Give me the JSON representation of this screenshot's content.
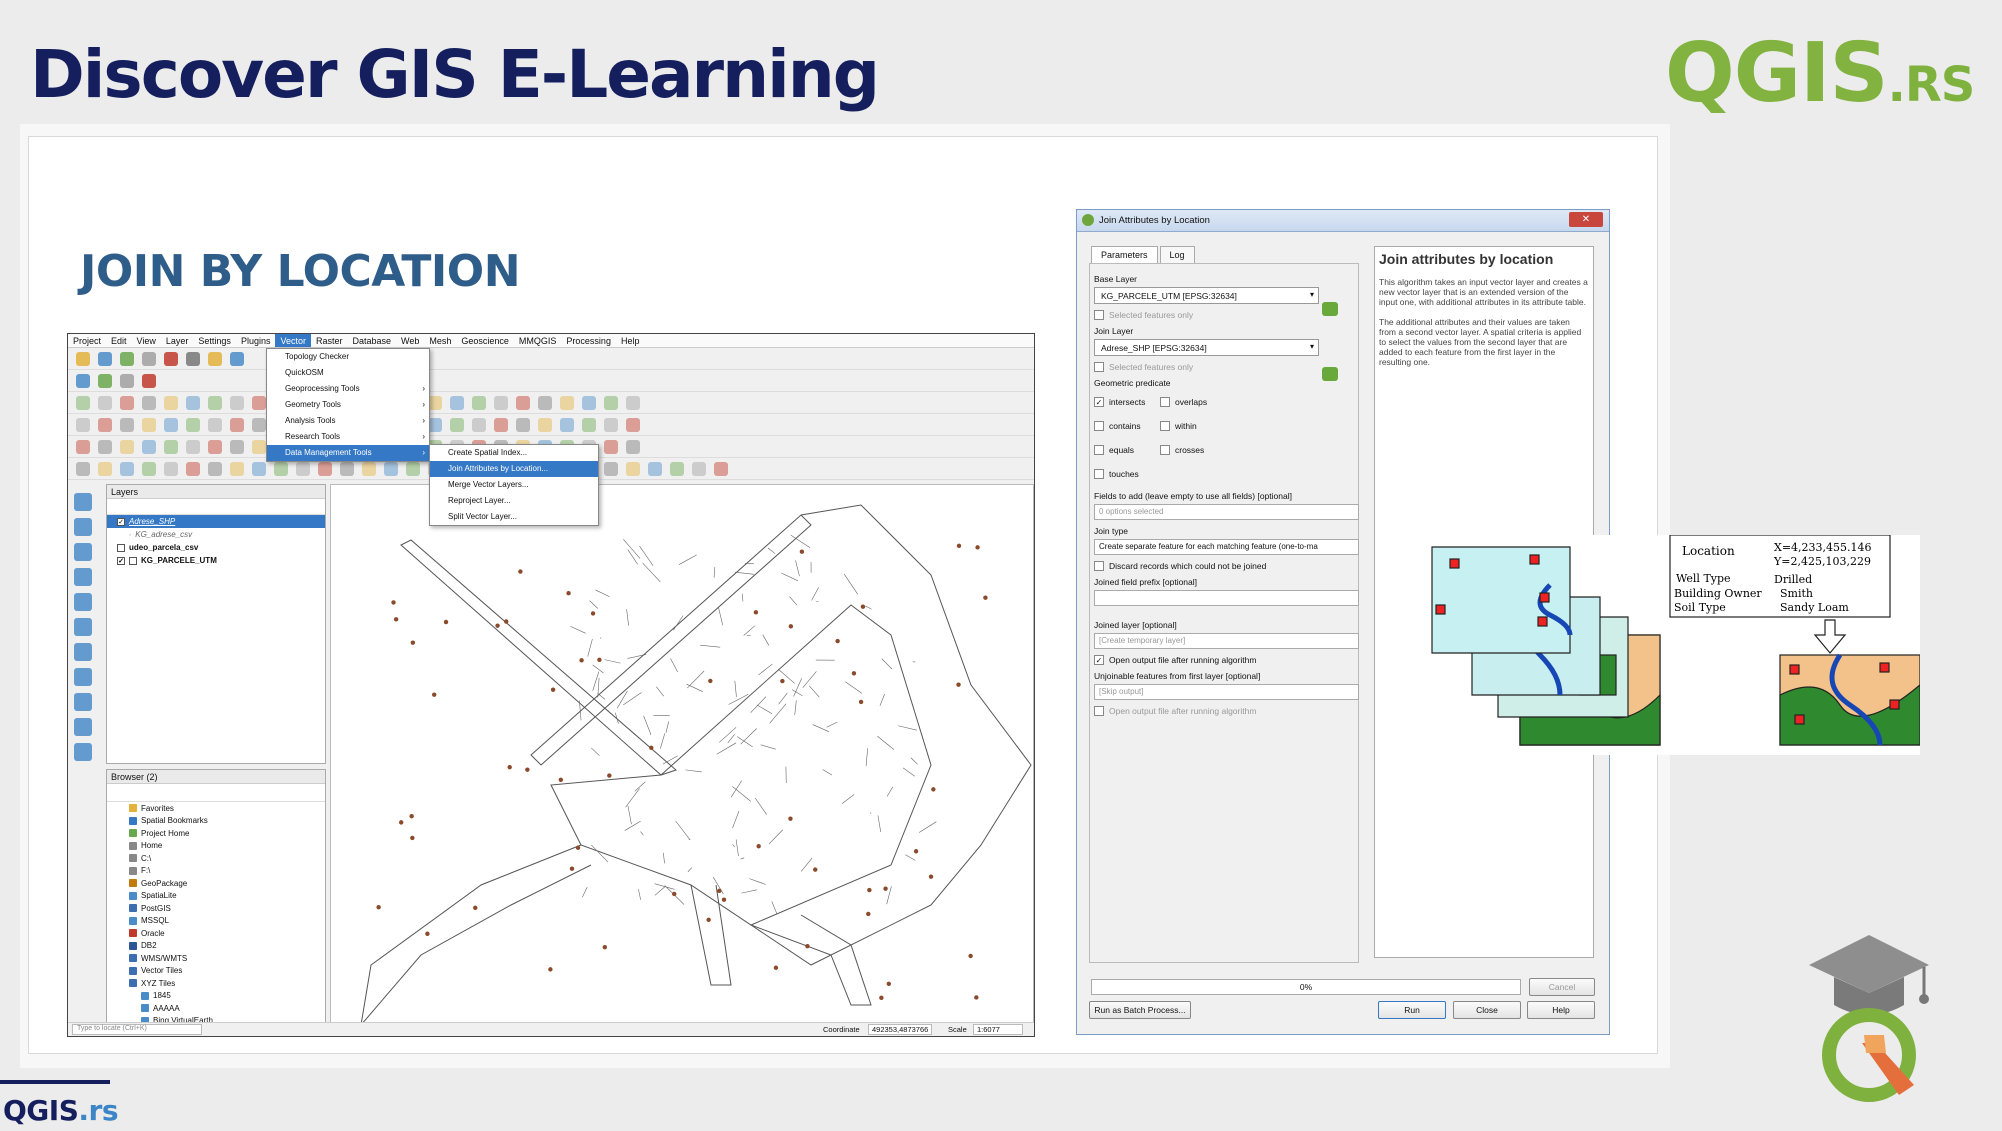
{
  "header": {
    "title": "Discover GIS E-Learning",
    "brand": "QGIS",
    "brand_suffix": ".RS"
  },
  "slide": {
    "section_title": "JOIN BY LOCATION"
  },
  "qgis": {
    "menu": [
      "Project",
      "Edit",
      "View",
      "Layer",
      "Settings",
      "Plugins",
      "Vector",
      "Raster",
      "Database",
      "Web",
      "Mesh",
      "Geoscience",
      "MMQGIS",
      "Processing",
      "Help"
    ],
    "vector_menu": [
      "Topology Checker",
      "QuickOSM",
      "Geoprocessing Tools",
      "Geometry Tools",
      "Analysis Tools",
      "Research Tools",
      "Data Management Tools"
    ],
    "submenu": [
      "Create Spatial Index...",
      "Join Attributes by Location...",
      "Merge Vector Layers...",
      "Reproject Layer...",
      "Split Vector Layer..."
    ],
    "layers_title": "Layers",
    "layers": [
      "Adrese_SHP",
      "KG_adrese_csv",
      "udeo_parcela_csv",
      "KG_PARCELE_UTM"
    ],
    "browser_title": "Browser (2)",
    "browser": [
      "Favorites",
      "Spatial Bookmarks",
      "Project Home",
      "Home",
      "C:\\",
      "F:\\",
      "GeoPackage",
      "SpatiaLite",
      "PostGIS",
      "MSSQL",
      "Oracle",
      "DB2",
      "WMS/WMTS",
      "Vector Tiles",
      "XYZ Tiles",
      "1845",
      "AAAAA",
      "Bing VirtualEarth"
    ],
    "locate_placeholder": "Type to locate (Ctrl+K)",
    "coordinate_label": "Coordinate",
    "coordinate_value": "492353,4873766",
    "scale_label": "Scale",
    "scale_value": "1:6077"
  },
  "dialog": {
    "title": "Join Attributes by Location",
    "tabs": [
      "Parameters",
      "Log"
    ],
    "base_layer_label": "Base Layer",
    "base_layer_value": "KG_PARCELE_UTM [EPSG:32634]",
    "selected_only": "Selected features only",
    "join_layer_label": "Join Layer",
    "join_layer_value": "Adrese_SHP [EPSG:32634]",
    "predicate_label": "Geometric predicate",
    "predicates": [
      "intersects",
      "overlaps",
      "contains",
      "within",
      "equals",
      "crosses",
      "touches"
    ],
    "fields_label": "Fields to add (leave empty to use all fields) [optional]",
    "fields_value": "0 options selected",
    "join_type_label": "Join type",
    "join_type_value": "Create separate feature for each matching feature (one-to-ma",
    "discard_label": "Discard records which could not be joined",
    "prefix_label": "Joined field prefix [optional]",
    "joined_layer_label": "Joined layer [optional]",
    "joined_layer_value": "[Create temporary layer]",
    "open_output": "Open output file after running algorithm",
    "unjoinable_label": "Unjoinable features from first layer [optional]",
    "unjoinable_value": "[Skip output]",
    "open_output2": "Open output file after running algorithm",
    "help_title": "Join attributes by location",
    "help_p1": "This algorithm takes an input vector layer and creates a new vector layer that is an extended version of the input one, with additional attributes in its attribute table.",
    "help_p2": "The additional attributes and their values are taken from a second vector layer. A spatial criteria is applied to select the values from the second layer that are added to each feature from the first layer in the resulting one.",
    "progress": "0%",
    "cancel": "Cancel",
    "batch": "Run as Batch Process...",
    "run": "Run",
    "close": "Close",
    "help": "Help"
  },
  "diagram": {
    "location": "Location",
    "x": "X=4,233,455.146",
    "y": "Y=2,425,103,229",
    "well_type": "Well Type",
    "well_type_value": "Drilled",
    "owner": "Building Owner",
    "owner_value": "Smith",
    "soil": "Soil Type",
    "soil_value": "Sandy Loam"
  },
  "footer": {
    "brand": "QGIS",
    "brand_suffix": ".rs"
  }
}
